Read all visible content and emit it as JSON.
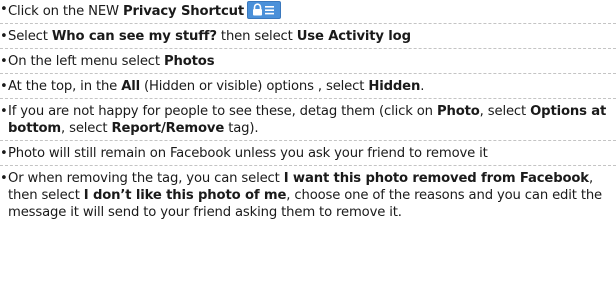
{
  "bullet": "•",
  "items": [
    {
      "t0": "Click on the NEW ",
      "b0": "Privacy Shortcut",
      "icon": "privacy-shortcut-lock-icon"
    },
    {
      "t0": "Select ",
      "b0": "Who can see my stuff?",
      "t1": " then select ",
      "b1": "Use Activity log"
    },
    {
      "t0": "On the left menu select ",
      "b0": "Photos"
    },
    {
      "t0": "At the top, in the ",
      "b0": "All",
      "t1": " (Hidden or visible) options , select ",
      "b1": "Hidden",
      "t2": "."
    },
    {
      "t0": "If you are not happy for people to see these, detag them (click on ",
      "b0": "Photo",
      "t1": ", select ",
      "b1": "Options at bottom",
      "t2": ", select ",
      "b2": "Report/Remove",
      "t3": " tag)."
    },
    {
      "t0": "Photo will still remain on Facebook unless you ask your friend to remove it"
    },
    {
      "t0": "Or when removing the tag, you can select ",
      "b0": "I want this photo removed from Facebook",
      "t1": ", then select ",
      "b1": "I don’t like this photo of me",
      "t2": ", choose one of the reasons and you can edit the message it will send to your friend asking them to remove it."
    }
  ],
  "colors": {
    "icon_background": "#4a90d9",
    "divider": "#c4c4c4",
    "text": "#1a1a1a"
  }
}
